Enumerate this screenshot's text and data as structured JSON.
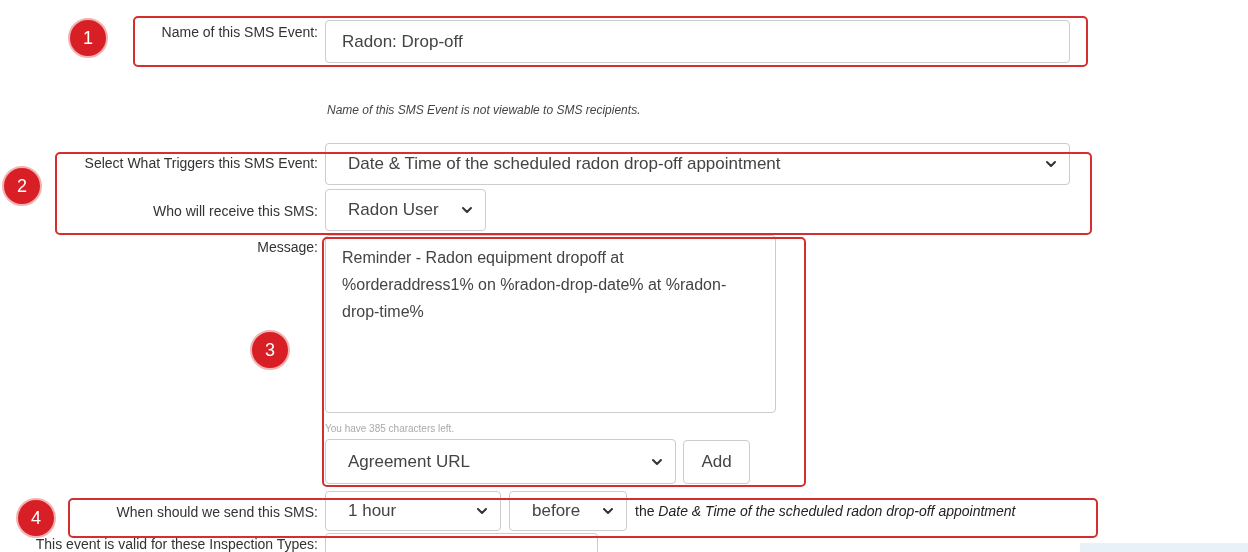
{
  "event_name": {
    "label": "Name of this SMS Event:",
    "value": "Radon: Drop-off",
    "help": "Name of this SMS Event is not viewable to SMS recipients."
  },
  "trigger": {
    "label": "Select What Triggers this SMS Event:",
    "value": "Date & Time of the scheduled radon drop-off appointment"
  },
  "recipient": {
    "label": "Who will receive this SMS:",
    "value": "Radon User"
  },
  "message": {
    "label": "Message:",
    "value": "Reminder - Radon equipment dropoff at %orderaddress1% on %radon-drop-date% at %radon-drop-time%",
    "counter": "You have 385 characters left.",
    "insert_value": "Agreement URL",
    "add_button": "Add"
  },
  "timing": {
    "label": "When should we send this SMS:",
    "amount": "1 hour",
    "relation": "before",
    "suffix": "the *Date & Time of the scheduled radon drop-off appointment*"
  },
  "inspection_types": {
    "label": "This event is valid for these Inspection Types:"
  },
  "annotations": [
    {
      "number": "1"
    },
    {
      "number": "2"
    },
    {
      "number": "3"
    },
    {
      "number": "4"
    }
  ]
}
